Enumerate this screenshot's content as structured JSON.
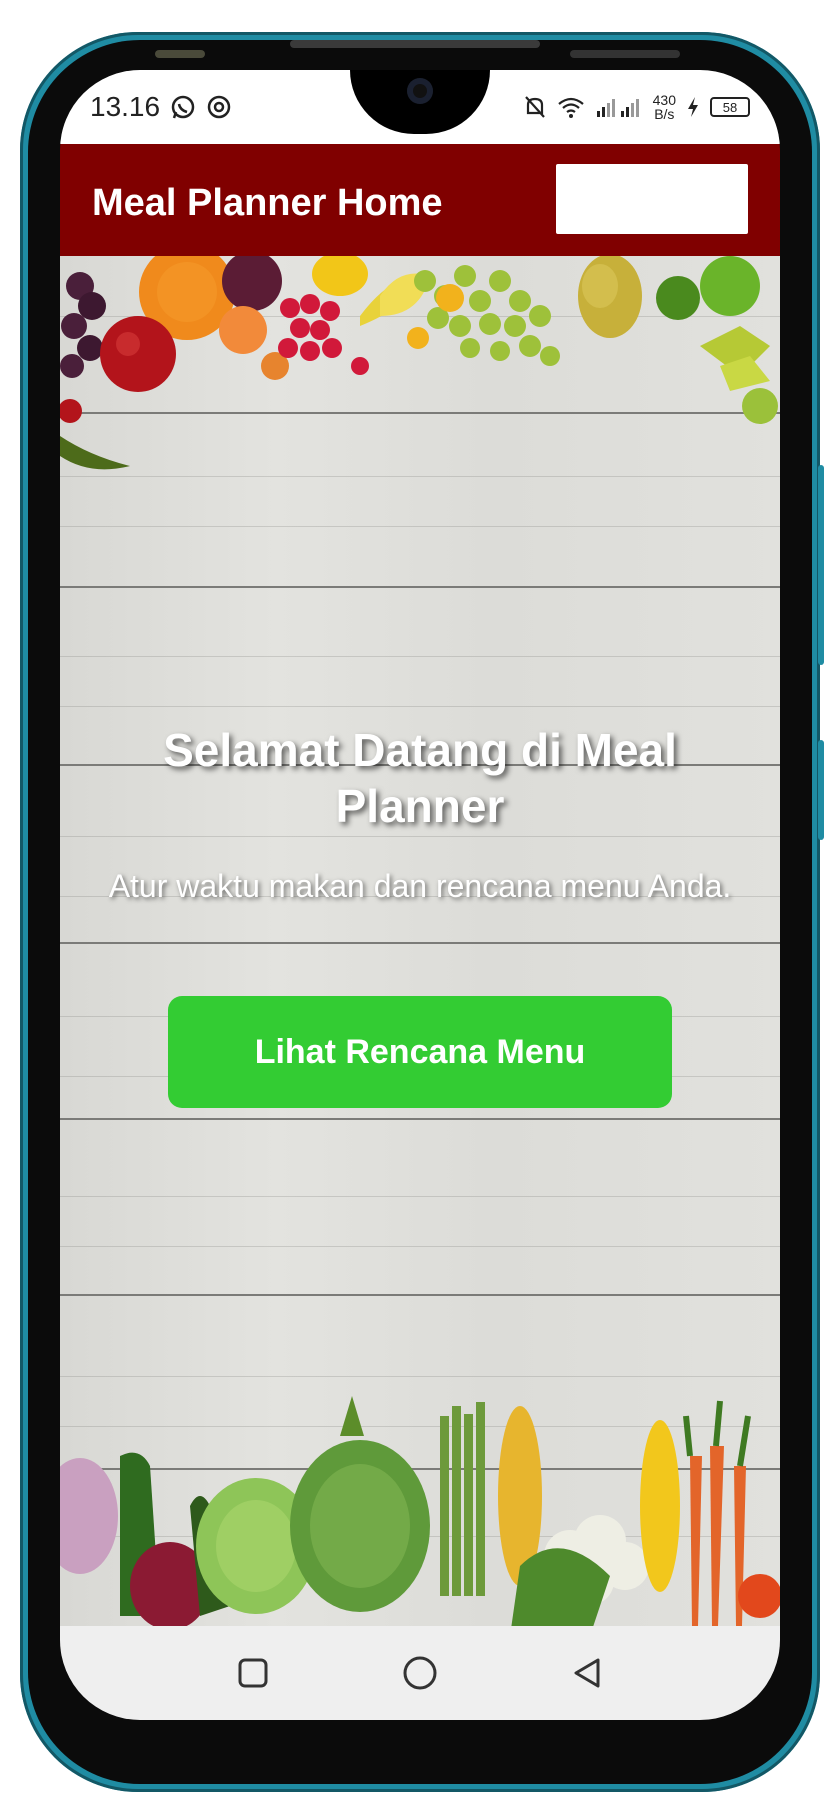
{
  "status_bar": {
    "time": "13.16",
    "net_speed_value": "430",
    "net_speed_unit": "B/s",
    "battery": "58",
    "icons": [
      "whatsapp-icon",
      "sync-icon",
      "bell-off-icon",
      "wifi-icon",
      "signal-icon",
      "charging-icon",
      "battery-icon"
    ]
  },
  "app_bar": {
    "title": "Meal Planner Home",
    "color": "#800000"
  },
  "hero": {
    "title": "Selamat Datang di Meal Planner",
    "subtitle": "Atur waktu makan dan rencana menu Anda.",
    "cta_label": "Lihat Rencana Menu",
    "cta_color": "#33cc33"
  },
  "nav_bar": {
    "icons": [
      "square-icon",
      "circle-icon",
      "back-triangle-icon"
    ]
  },
  "phone": {
    "frame_color": "#1f8ca3"
  }
}
